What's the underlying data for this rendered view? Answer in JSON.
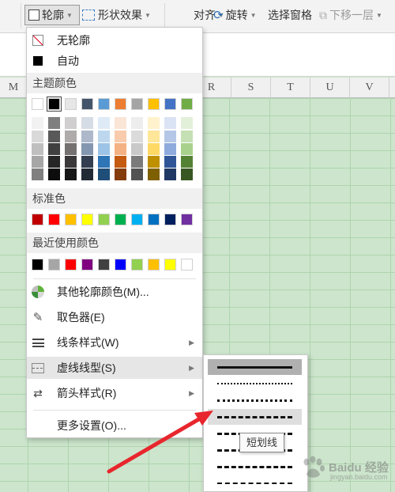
{
  "toolbar": {
    "outline_label": "轮廓",
    "shape_effect_label": "形状效果",
    "align_label": "对齐",
    "rotate_label": "旋转",
    "selection_pane_label": "选择窗格",
    "send_back_label": "下移一层"
  },
  "columns": [
    "M",
    "R",
    "S",
    "T",
    "U",
    "V"
  ],
  "menu": {
    "no_outline": "无轮廓",
    "automatic": "自动",
    "theme_colors_title": "主题颜色",
    "standard_colors_title": "标准色",
    "recent_colors_title": "最近使用颜色",
    "more_outline_colors": "其他轮廓颜色(M)...",
    "eyedropper": "取色器(E)",
    "line_style": "线条样式(W)",
    "dash_type": "虚线线型(S)",
    "arrow_style": "箭头样式(R)",
    "more_settings": "更多设置(O)..."
  },
  "theme_colors": [
    "#ffffff",
    "#000000",
    "#e7e6e6",
    "#44546a",
    "#5b9bd5",
    "#ed7d31",
    "#a5a5a5",
    "#ffc000",
    "#4472c4",
    "#70ad47"
  ],
  "theme_shades": [
    [
      "#f2f2f2",
      "#d9d9d9",
      "#bfbfbf",
      "#a6a6a6",
      "#808080"
    ],
    [
      "#7f7f7f",
      "#595959",
      "#404040",
      "#262626",
      "#0d0d0d"
    ],
    [
      "#d0cece",
      "#afabab",
      "#757171",
      "#3a3838",
      "#171616"
    ],
    [
      "#d6dce5",
      "#adb9ca",
      "#8497b0",
      "#333f50",
      "#222a35"
    ],
    [
      "#deebf7",
      "#bdd7ee",
      "#9dc3e6",
      "#2e75b6",
      "#1f4e79"
    ],
    [
      "#fbe5d6",
      "#f8cbad",
      "#f4b183",
      "#c55a11",
      "#843c0c"
    ],
    [
      "#ededed",
      "#dbdbdb",
      "#c9c9c9",
      "#7b7b7b",
      "#525252"
    ],
    [
      "#fff2cc",
      "#ffe699",
      "#ffd966",
      "#bf9000",
      "#7f6000"
    ],
    [
      "#dae3f3",
      "#b4c7e7",
      "#8faadc",
      "#2f5597",
      "#203864"
    ],
    [
      "#e2f0d9",
      "#c5e0b4",
      "#a9d18e",
      "#548235",
      "#385723"
    ]
  ],
  "standard_colors": [
    "#c00000",
    "#ff0000",
    "#ffc000",
    "#ffff00",
    "#92d050",
    "#00b050",
    "#00b0f0",
    "#0070c0",
    "#002060",
    "#7030a0"
  ],
  "recent_colors": [
    "#000000",
    "#a6a6a6",
    "#ff0000",
    "#800080",
    "#404040",
    "#0000ff",
    "#92d050",
    "#ffc000",
    "#ffff00",
    "#ffffff"
  ],
  "selected_theme_color": "#000000",
  "dash_types": [
    "solid",
    "round-dot",
    "square-dot",
    "dash",
    "dash-dot",
    "long-dash",
    "long-dash-dot",
    "long-dash-dot-dot"
  ],
  "hovered_dash_type": "dash",
  "tooltip_text": "短划线",
  "watermark": {
    "text": "Baidu 经验",
    "url": "jingyan.baidu.com"
  },
  "annotation_arrow_color": "#e8262d"
}
